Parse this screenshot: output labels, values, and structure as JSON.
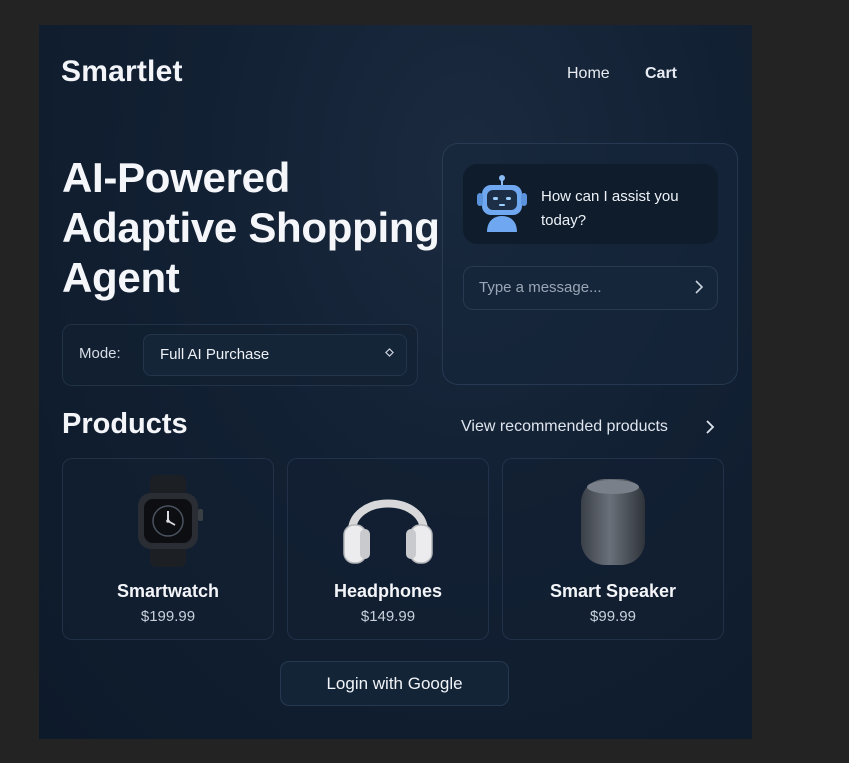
{
  "header": {
    "brand": "Smartlet",
    "nav": {
      "home": "Home",
      "cart": "Cart"
    }
  },
  "hero": {
    "title": "AI-Powered Adaptive Shopping Agent",
    "mode_label": "Mode:",
    "mode_value": "Full AI Purchase"
  },
  "chat": {
    "greeting": "How can I assist you today?",
    "input_placeholder": "Type a message...",
    "avatar_icon": "robot-icon",
    "send_icon": "chevron-right-icon"
  },
  "products": {
    "title": "Products",
    "view_link": "View recommended products",
    "items": [
      {
        "name": "Smartwatch",
        "price": "$199.99",
        "icon": "smartwatch-icon"
      },
      {
        "name": "Headphones",
        "price": "$149.99",
        "icon": "headphones-icon"
      },
      {
        "name": "Smart Speaker",
        "price": "$99.99",
        "icon": "speaker-icon"
      }
    ]
  },
  "auth": {
    "login_label": "Login with Google"
  },
  "colors": {
    "background": "#122033",
    "accent_robot": "#6fa8f0",
    "text": "#eef1f6"
  }
}
